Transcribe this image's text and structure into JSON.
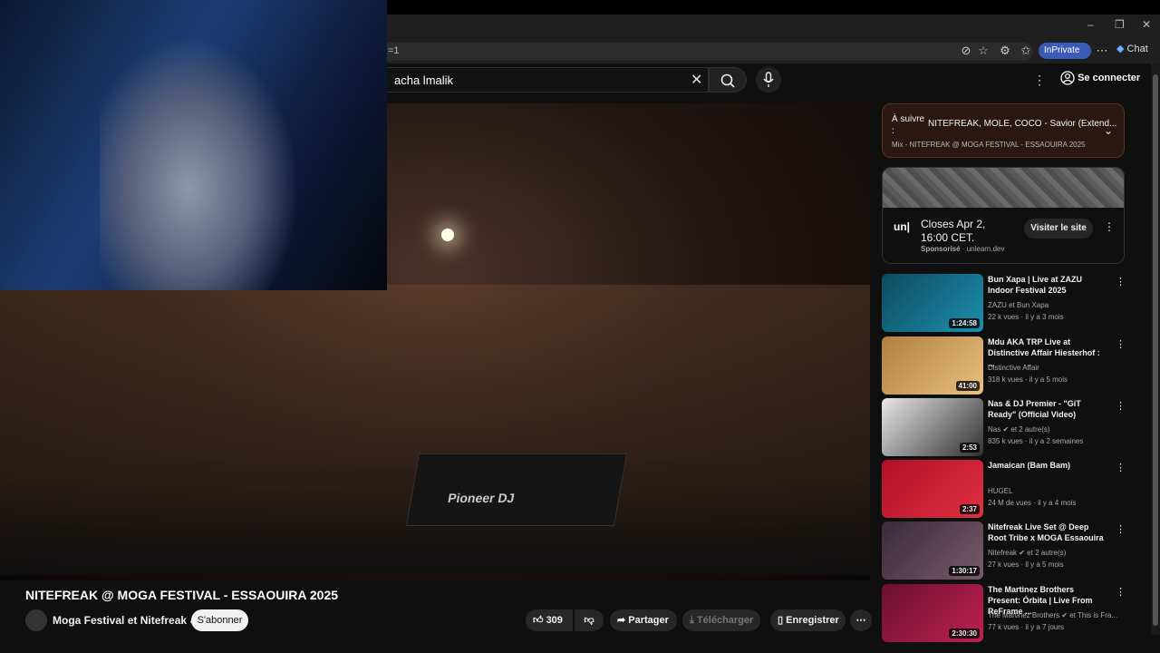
{
  "browser": {
    "url_fragment": "=1",
    "inprivate_label": "InPrivate",
    "chat_label": "Chat",
    "window_controls": [
      "–",
      "❐",
      "✕"
    ]
  },
  "header": {
    "search_value": "acha lmalik",
    "signin_label": "Se connecter"
  },
  "video": {
    "title": "NITEFREAK @ MOGA FESTIVAL - ESSAOUIRA 2025",
    "deck_brand": "Pioneer DJ",
    "channel_name": "Moga Festival et Nitefreak",
    "subscribe_label": "S'abonner",
    "like_count": "309",
    "share_label": "Partager",
    "download_label": "Télécharger",
    "save_label": "Enregistrer"
  },
  "up_next": {
    "label": "À suivre :",
    "title": "NITEFREAK, MOLE, COCO - Savior (Extend...",
    "subtitle": "Mix - NITEFREAK @ MOGA FESTIVAL - ESSAOUIRA 2025"
  },
  "ad": {
    "logo": "un|",
    "text": "Closes Apr 2, 16:00 CET.",
    "sponsored": "Sponsorisé",
    "domain": "unlearn.dev",
    "visit_label": "Visiter le site"
  },
  "recommendations": [
    {
      "title": "Bun Xapa | Live at ZAZU Indoor Festival 2025",
      "channel": "ZAZU et Bun Xapa",
      "meta": "22 k vues · il y a 3 mois",
      "duration": "1:24:58",
      "colors": [
        "#0e4a5e",
        "#1c8fb0"
      ]
    },
    {
      "title": "Mdu AKA TRP Live at Distinctive Affair Hiesterhof : ...",
      "channel": "Distinctive Affair",
      "meta": "318 k vues · il y a 5 mois",
      "duration": "41:00",
      "colors": [
        "#b08040",
        "#e8c080"
      ]
    },
    {
      "title": "Nas & DJ Premier - \"GiT Ready\" (Official Video)",
      "channel": "Nas",
      "channel_extra": "et 2 autre(s)",
      "meta": "835 k vues · il y a 2 semaines",
      "duration": "2:53",
      "colors": [
        "#e8e8e8",
        "#303030"
      ]
    },
    {
      "title": "Jamaican (Bam Bam)",
      "channel": "HUGEL",
      "meta": "24 M de vues · il y a 4 mois",
      "duration": "2:37",
      "colors": [
        "#b0102a",
        "#e03040"
      ]
    },
    {
      "title": "Nitefreak Live Set @ Deep Root Tribe x MOGA Essaouira",
      "channel": "Nitefreak",
      "channel_extra": "et 2 autre(s)",
      "meta": "27 k vues · il y a 5 mois",
      "duration": "1:30:17",
      "colors": [
        "#3a2a3a",
        "#7a5a6a"
      ]
    },
    {
      "title": "The Martinez Brothers Present: Órbita | Live From ReFrame ...",
      "channel": "The Martinez Brothers",
      "channel_extra": "et This is Fra...",
      "meta": "77 k vues · il y a 7 jours",
      "duration": "2:30:30",
      "colors": [
        "#6a1030",
        "#c02050"
      ]
    }
  ]
}
